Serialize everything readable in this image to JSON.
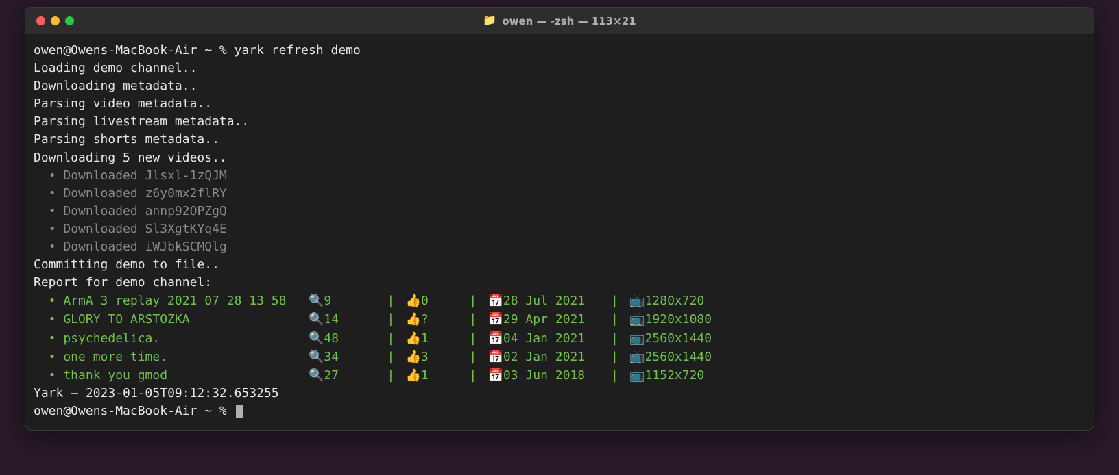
{
  "window": {
    "title": "owen — -zsh — 113×21",
    "folder_icon": "📁"
  },
  "prompt1": "owen@Owens-MacBook-Air ~ % ",
  "command": "yark refresh demo",
  "lines": [
    "Loading demo channel..",
    "Downloading metadata..",
    "Parsing video metadata..",
    "Parsing livestream metadata..",
    "Parsing shorts metadata..",
    "Downloading 5 new videos.."
  ],
  "downloads": [
    "Downloaded Jlsxl-1zQJM",
    "Downloaded z6y0mx2flRY",
    "Downloaded annp92OPZgQ",
    "Downloaded Sl3XgtKYq4E",
    "Downloaded iWJbkSCMQlg"
  ],
  "commit_line": "Committing demo to file..",
  "report_header": "Report for demo channel:",
  "icons": {
    "views": "🔍",
    "likes": "👍",
    "date": "📅",
    "res": "📺"
  },
  "separator": "|",
  "report": [
    {
      "title": "ArmA 3 replay 2021 07 28 13 58",
      "views": "9",
      "likes": "0",
      "date": "28 Jul 2021",
      "res": "1280x720"
    },
    {
      "title": "GLORY TO ARSTOZKA",
      "views": "14",
      "likes": "?",
      "date": "29 Apr 2021",
      "res": "1920x1080"
    },
    {
      "title": "psychedelica.",
      "views": "48",
      "likes": "1",
      "date": "04 Jan 2021",
      "res": "2560x1440"
    },
    {
      "title": "one more time.",
      "views": "34",
      "likes": "3",
      "date": "02 Jan 2021",
      "res": "2560x1440"
    },
    {
      "title": "thank you gmod",
      "views": "27",
      "likes": "1",
      "date": "03 Jun 2018",
      "res": "1152x720"
    }
  ],
  "footer": "Yark — 2023-01-05T09:12:32.653255",
  "prompt2": "owen@Owens-MacBook-Air ~ % "
}
